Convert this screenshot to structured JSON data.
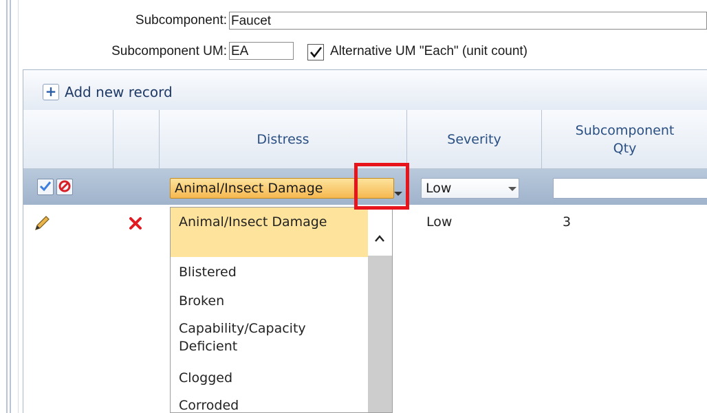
{
  "form": {
    "subcomponent_label": "Subcomponent:",
    "subcomponent_value": "Faucet",
    "um_label": "Subcomponent UM:",
    "um_value": "EA",
    "alt_um_checked": true,
    "alt_um_label": "Alternative UM \"Each\" (unit count)"
  },
  "toolbar": {
    "add_label": "Add new record"
  },
  "columns": [
    {
      "label": ""
    },
    {
      "label": ""
    },
    {
      "label": "Distress"
    },
    {
      "label": "Severity"
    },
    {
      "label": "Subcomponent\nQty"
    }
  ],
  "edit_row": {
    "distress_value": "Animal/Insect Damage",
    "severity_value": "Low",
    "qty_value": ""
  },
  "rows": [
    {
      "distress": "Animal/Insect Damage",
      "severity": "Low",
      "qty": "3"
    }
  ],
  "dropdown": {
    "options": [
      {
        "label": "Animal/Insect Damage",
        "selected": true
      },
      {
        "label": "Blistered"
      },
      {
        "label": "Broken"
      },
      {
        "label": "Capability/Capacity Deficient"
      },
      {
        "label": "Clogged"
      },
      {
        "label": "Corroded"
      }
    ]
  },
  "colors": {
    "highlight": "#e8141c",
    "selected_bg": "#fde39c",
    "header_text": "#2a4f82"
  }
}
